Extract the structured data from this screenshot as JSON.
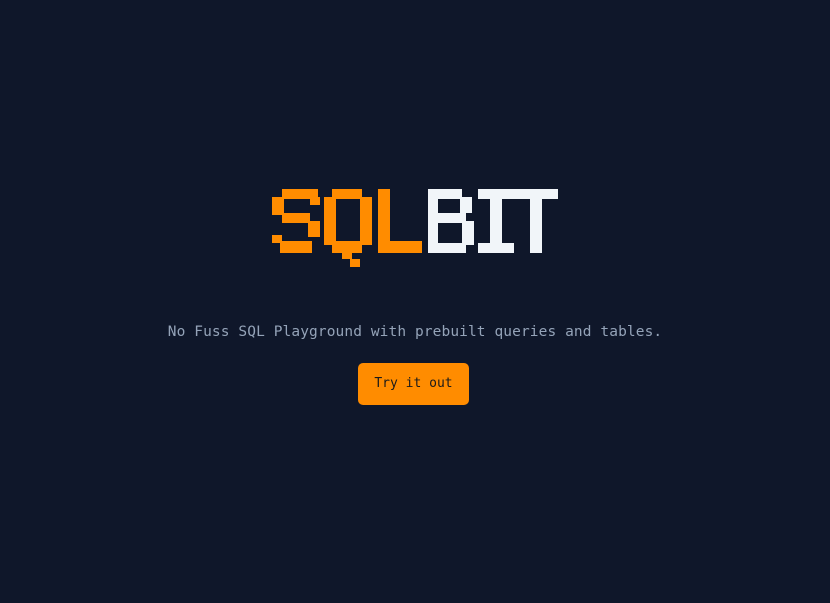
{
  "logo": {
    "part1": "SQL",
    "part2": "BIT",
    "color1": "#ff8c00",
    "color2": "#f1f5f9"
  },
  "tagline": "No Fuss SQL Playground with prebuilt queries and tables.",
  "cta": {
    "label": "Try it out",
    "background": "#ff8c00"
  },
  "colors": {
    "background": "#0f172a",
    "tagline": "#94a3b8"
  }
}
